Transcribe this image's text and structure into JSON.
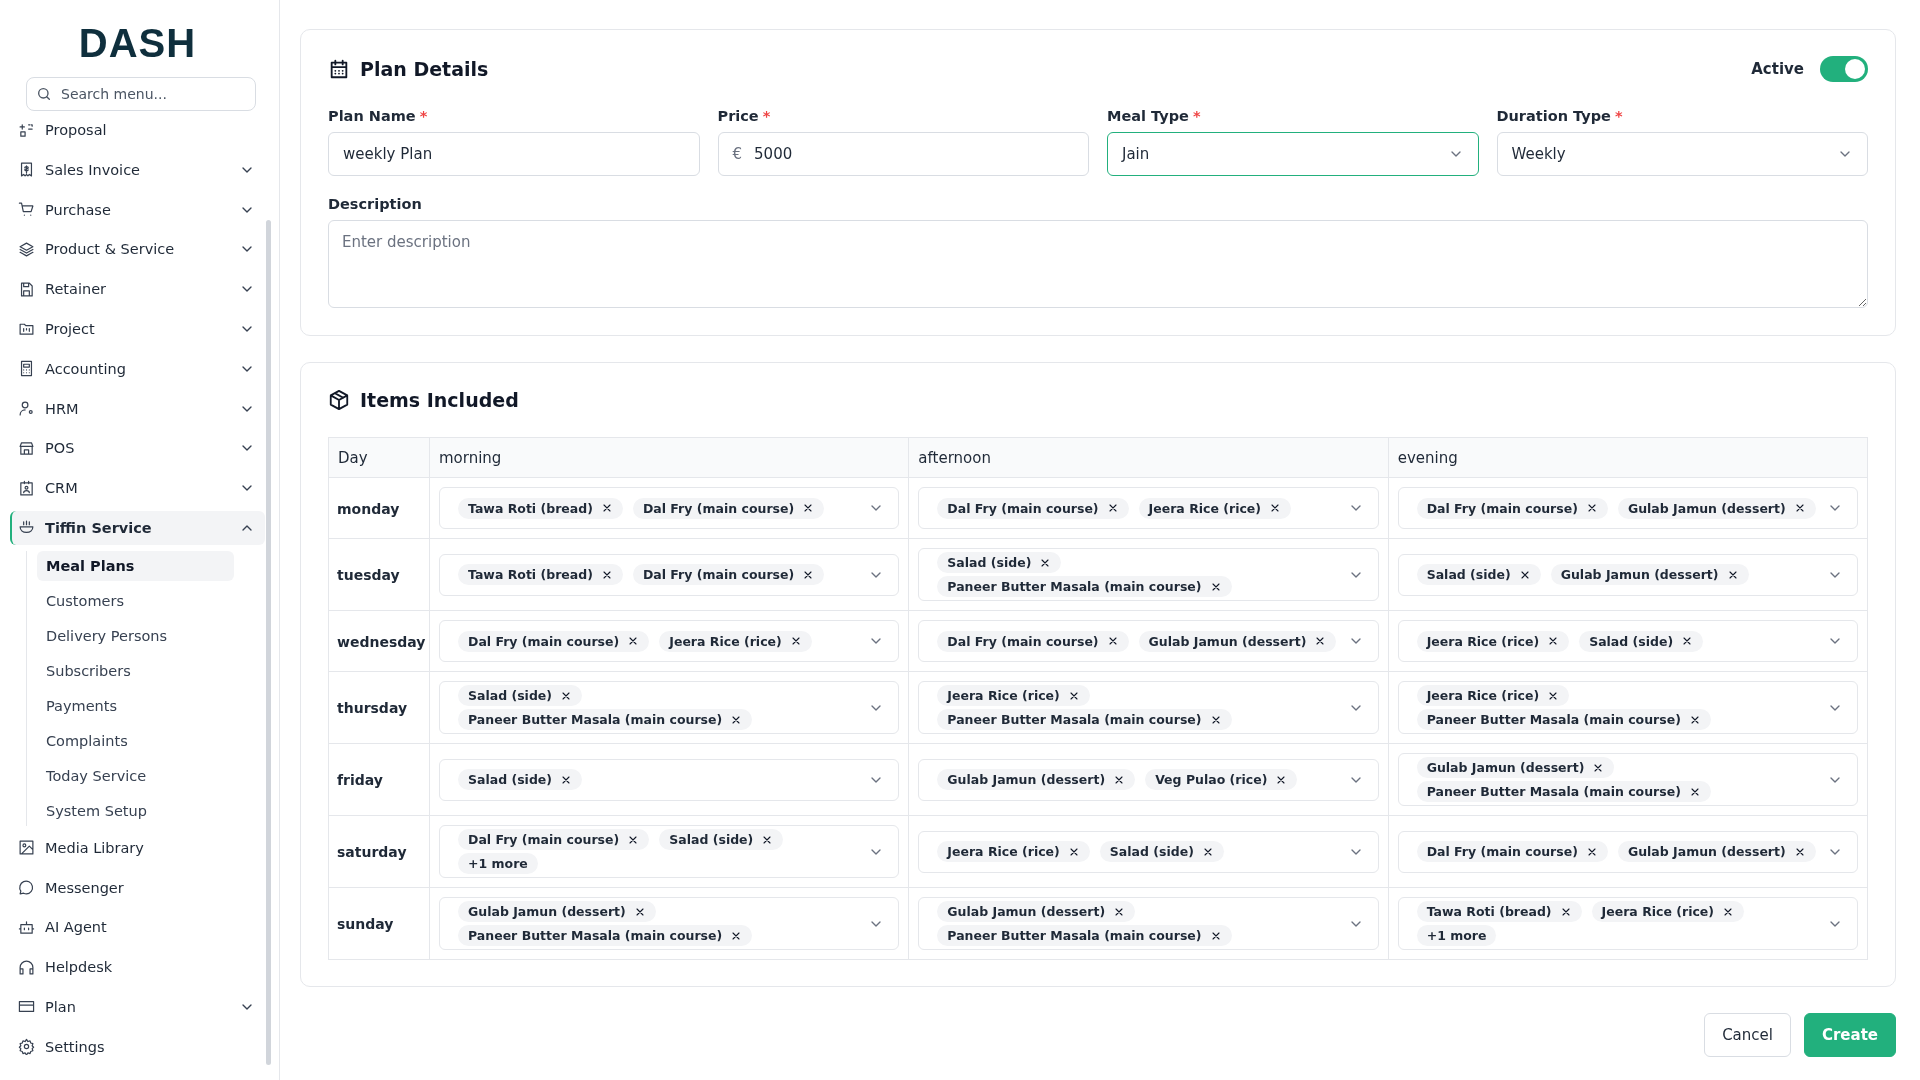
{
  "sidebar": {
    "logo": "DASH",
    "search": {
      "placeholder": "Search menu..."
    },
    "items": [
      {
        "label": "Proposal",
        "selected": false
      },
      {
        "label": "Sales Invoice",
        "has_submenu": true,
        "expanded": false,
        "selected": false
      },
      {
        "label": "Purchase",
        "has_submenu": true,
        "expanded": false,
        "selected": false
      },
      {
        "label": "Product & Service",
        "has_submenu": true,
        "expanded": false,
        "selected": false
      },
      {
        "label": "Retainer",
        "has_submenu": true,
        "expanded": false,
        "selected": false
      },
      {
        "label": "Project",
        "has_submenu": true,
        "expanded": false,
        "selected": false
      },
      {
        "label": "Accounting",
        "has_submenu": true,
        "expanded": false,
        "selected": false
      },
      {
        "label": "HRM",
        "has_submenu": true,
        "expanded": false,
        "selected": false
      },
      {
        "label": "POS",
        "has_submenu": true,
        "expanded": false,
        "selected": false
      },
      {
        "label": "CRM",
        "has_submenu": true,
        "expanded": false,
        "selected": false
      },
      {
        "label": "Tiffin Service",
        "has_submenu": true,
        "expanded": true,
        "selected": true,
        "children": [
          {
            "label": "Meal Plans",
            "selected": true
          },
          {
            "label": "Customers",
            "selected": false
          },
          {
            "label": "Delivery Persons",
            "selected": false
          },
          {
            "label": "Subscribers",
            "selected": false
          },
          {
            "label": "Payments",
            "selected": false
          },
          {
            "label": "Complaints",
            "selected": false
          },
          {
            "label": "Today Service",
            "selected": false
          },
          {
            "label": "System Setup",
            "selected": false
          }
        ]
      },
      {
        "label": "Media Library",
        "selected": false
      },
      {
        "label": "Messenger",
        "selected": false
      },
      {
        "label": "AI Agent",
        "selected": false
      },
      {
        "label": "Helpdesk",
        "selected": false
      },
      {
        "label": "Plan",
        "has_submenu": true,
        "expanded": false,
        "selected": false
      },
      {
        "label": "Settings",
        "selected": false
      }
    ]
  },
  "plan_details": {
    "title": "Plan Details",
    "active": {
      "label": "Active",
      "on": true
    },
    "required_marker": "*",
    "fields": [
      {
        "kind": "text",
        "label": "Plan Name",
        "required": true,
        "value": "weekly Plan",
        "focused": false
      },
      {
        "kind": "price",
        "label": "Price",
        "required": true,
        "prefix": "€",
        "value": "5000",
        "focused": false
      },
      {
        "kind": "select",
        "label": "Meal Type",
        "required": true,
        "value": "Jain",
        "focused": true
      },
      {
        "kind": "select",
        "label": "Duration Type",
        "required": true,
        "value": "Weekly",
        "focused": false
      }
    ],
    "description": {
      "label": "Description",
      "placeholder": "Enter description"
    }
  },
  "items_included": {
    "title": "Items Included",
    "columns": [
      "Day",
      "morning",
      "afternoon",
      "evening"
    ],
    "rows": [
      {
        "cells": [
          {
            "kind": "day",
            "text": "monday"
          },
          {
            "kind": "meals",
            "tags": [
              "Tawa Roti (bread)",
              "Dal Fry (main course)"
            ]
          },
          {
            "kind": "meals",
            "tags": [
              "Dal Fry (main course)",
              "Jeera Rice (rice)"
            ]
          },
          {
            "kind": "meals",
            "tags": [
              "Dal Fry (main course)",
              "Gulab Jamun (dessert)"
            ]
          }
        ]
      },
      {
        "cells": [
          {
            "kind": "day",
            "text": "tuesday"
          },
          {
            "kind": "meals",
            "tags": [
              "Tawa Roti (bread)",
              "Dal Fry (main course)"
            ]
          },
          {
            "kind": "meals",
            "tags": [
              "Salad (side)",
              "Paneer Butter Masala (main course)"
            ]
          },
          {
            "kind": "meals",
            "tags": [
              "Salad (side)",
              "Gulab Jamun (dessert)"
            ]
          }
        ]
      },
      {
        "cells": [
          {
            "kind": "day",
            "text": "wednesday"
          },
          {
            "kind": "meals",
            "tags": [
              "Dal Fry (main course)",
              "Jeera Rice (rice)"
            ]
          },
          {
            "kind": "meals",
            "tags": [
              "Dal Fry (main course)",
              "Gulab Jamun (dessert)"
            ]
          },
          {
            "kind": "meals",
            "tags": [
              "Jeera Rice (rice)",
              "Salad (side)"
            ]
          }
        ]
      },
      {
        "cells": [
          {
            "kind": "day",
            "text": "thursday"
          },
          {
            "kind": "meals",
            "tags": [
              "Salad (side)",
              "Paneer Butter Masala (main course)"
            ]
          },
          {
            "kind": "meals",
            "tags": [
              "Jeera Rice (rice)",
              "Paneer Butter Masala (main course)"
            ]
          },
          {
            "kind": "meals",
            "tags": [
              "Jeera Rice (rice)",
              "Paneer Butter Masala (main course)"
            ]
          }
        ]
      },
      {
        "cells": [
          {
            "kind": "day",
            "text": "friday"
          },
          {
            "kind": "meals",
            "tags": [
              "Salad (side)"
            ]
          },
          {
            "kind": "meals",
            "tags": [
              "Gulab Jamun (dessert)",
              "Veg Pulao (rice)"
            ]
          },
          {
            "kind": "meals",
            "tags": [
              "Gulab Jamun (dessert)",
              "Paneer Butter Masala (main course)"
            ]
          }
        ]
      },
      {
        "cells": [
          {
            "kind": "day",
            "text": "saturday"
          },
          {
            "kind": "meals",
            "tags": [
              "Dal Fry (main course)",
              "Salad (side)"
            ],
            "more": "+1 more"
          },
          {
            "kind": "meals",
            "tags": [
              "Jeera Rice (rice)",
              "Salad (side)"
            ]
          },
          {
            "kind": "meals",
            "tags": [
              "Dal Fry (main course)",
              "Gulab Jamun (dessert)"
            ]
          }
        ]
      },
      {
        "cells": [
          {
            "kind": "day",
            "text": "sunday"
          },
          {
            "kind": "meals",
            "tags": [
              "Gulab Jamun (dessert)",
              "Paneer Butter Masala (main course)"
            ]
          },
          {
            "kind": "meals",
            "tags": [
              "Gulab Jamun (dessert)",
              "Paneer Butter Masala (main course)"
            ]
          },
          {
            "kind": "meals",
            "tags": [
              "Tawa Roti (bread)",
              "Jeera Rice (rice)"
            ],
            "more": "+1 more"
          }
        ]
      }
    ]
  },
  "buttons": [
    {
      "kind": "secondary",
      "label": "Cancel"
    },
    {
      "kind": "primary",
      "label": "Create"
    }
  ]
}
